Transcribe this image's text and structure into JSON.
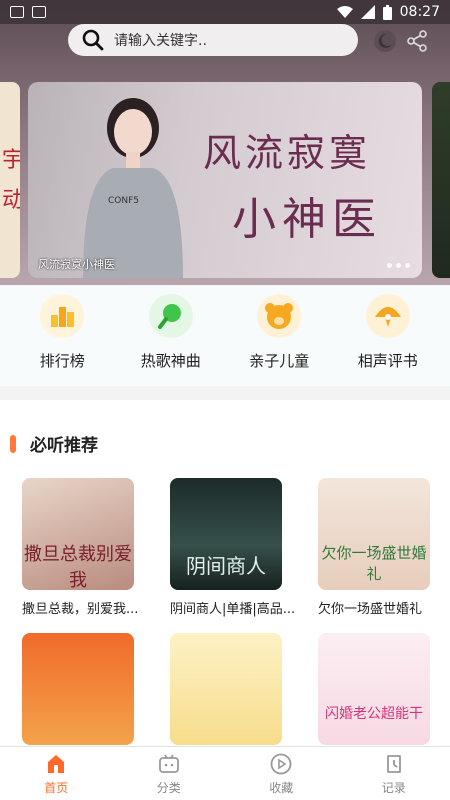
{
  "status_bar": {
    "time": "08:27"
  },
  "search": {
    "placeholder": "请输入关键字.."
  },
  "banner": {
    "title_line1": "风流寂寞",
    "title_line2": "小神医",
    "caption": "风流寂寞小神医"
  },
  "quick_links": [
    {
      "label": "排行榜",
      "color": "#fbbf2a"
    },
    {
      "label": "热歌神曲",
      "color": "#3fc64a"
    },
    {
      "label": "亲子儿童",
      "color": "#f7a821"
    },
    {
      "label": "相声评书",
      "color": "#f5a621"
    }
  ],
  "section": {
    "title": "必听推荐"
  },
  "books": [
    {
      "name": "撒旦总裁，别爱我...",
      "cover_text": "撒旦总裁别爱我"
    },
    {
      "name": "阴间商人|单播|高品...",
      "cover_text": "阴间商人"
    },
    {
      "name": "欠你一场盛世婚礼",
      "cover_text": "欠你一场盛世婚礼"
    },
    {
      "name": "",
      "cover_text": ""
    },
    {
      "name": "",
      "cover_text": ""
    },
    {
      "name": "",
      "cover_text": "闪婚老公超能干"
    }
  ],
  "tabs": [
    {
      "label": "首页",
      "active": true
    },
    {
      "label": "分类",
      "active": false
    },
    {
      "label": "收藏",
      "active": false
    },
    {
      "label": "记录",
      "active": false
    }
  ],
  "colors": {
    "accent": "#ff6a2a"
  }
}
